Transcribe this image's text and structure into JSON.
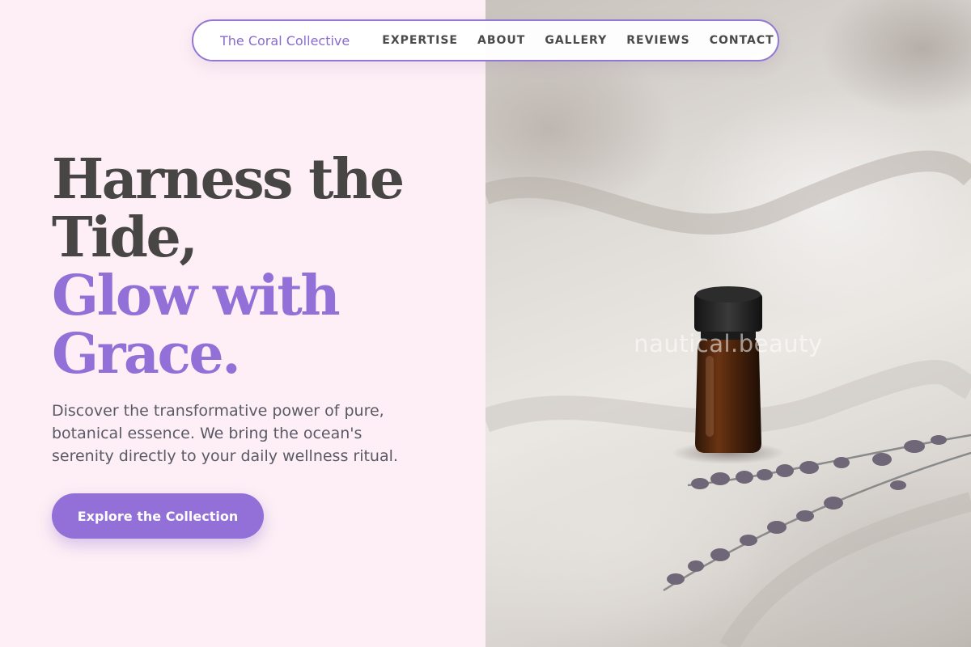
{
  "nav": {
    "brand": "The Coral Collective",
    "links": [
      "EXPERTISE",
      "ABOUT",
      "GALLERY",
      "REVIEWS",
      "CONTACT"
    ]
  },
  "hero": {
    "headline_line1": "Harness the",
    "headline_line2": "Tide,",
    "headline_line3": "Glow with",
    "headline_line4": "Grace.",
    "description": "Discover the transformative power of pure, botanical essence. We bring the ocean's serenity directly to your daily wellness ritual.",
    "cta_label": "Explore the Collection"
  },
  "image": {
    "watermark": "nautical.beauty",
    "icon": "essential-oil-bottle-with-lavender-photo"
  },
  "colors": {
    "accent": "#9270d8",
    "heading_dark": "#474645",
    "background_left": "#fdeff5",
    "body_text": "#5a5a66"
  }
}
